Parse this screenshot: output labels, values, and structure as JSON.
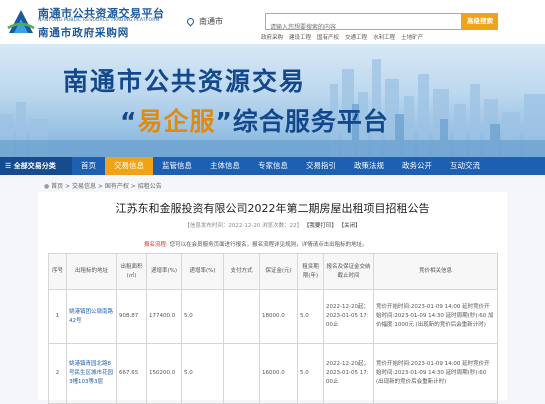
{
  "header": {
    "title_cn": "南通市公共资源交易平台",
    "title_en": "NANTONG PUBLIC RESOURCE TRADING PLATFORM",
    "subtitle_cn": "南通市政府采购网",
    "location": "南通市",
    "search_placeholder": "请输入您想要搜索的内容",
    "search_button": "高级搜索",
    "quick_links": [
      "政府采购",
      "建设工程",
      "国有产权",
      "交通工程",
      "水利工程",
      "土地矿产"
    ]
  },
  "banner": {
    "line1": "南通市公共资源交易",
    "line2_quote_open": "“",
    "line2_highlight": "易企服",
    "line2_quote_close": "”",
    "line2_rest": "综合服务平台"
  },
  "nav": {
    "category": "全部交易分类",
    "items": [
      "首页",
      "交易信息",
      "监管信息",
      "主体信息",
      "专家信息",
      "交易指引",
      "政策法规",
      "政务公开",
      "互动交流"
    ],
    "active_index": 1
  },
  "breadcrumb": "首页 > 交易信息 > 国有产权 > 招租公告",
  "article": {
    "title": "江苏东和金服投资有限公司2022年第二期房屋出租项目招租公告",
    "meta_prefix": "【信息发布时间：2022-12-20  浏览次数：22】",
    "print_label": "【我要打印】",
    "close_label": "【关闭】",
    "notice_label": "报名流程:",
    "notice_text": "您可以在会员服务页面进行报名，报名流程详见规则，详情请点击出租标的地址。"
  },
  "table": {
    "headers": [
      "序号",
      "出租标的地址",
      "出租面积(㎡)",
      "递增率(%)",
      "递增率(%)",
      "支付方式",
      "保证金(元)",
      "租赁期限(年)",
      "报名及保证金交纳截止时间",
      "竞价相关信息"
    ],
    "rows": [
      {
        "no": "1",
        "address": "姚港镇团公墩南路42号",
        "area": "908.87",
        "price": "177400.0",
        "rate": "5.0",
        "pay": "",
        "deposit": "18000.0",
        "term": "5.0",
        "deadline": "2022-12-20起；2023-01-05 17:00止",
        "bid": "竞价开始时间:2023-01-09 14:00 延时竞价开始时间:2023-01-09 14:30 延时周期(秒):60 加价幅度:1000元 (出现新的竞价后会重新计时)"
      },
      {
        "no": "2",
        "address": "姚港镇青园北路8号民生区城市花园3幢103等3层",
        "area": "667.65",
        "price": "150200.0",
        "rate": "5.0",
        "pay": "",
        "deposit": "16000.0",
        "term": "5.0",
        "deadline": "2022-12-20起；2023-01-05 17:00止",
        "bid": "竞价开始时间:2023-01-09 14:00 延时竞价开始时间:2023-01-09 14:30 延时周期(秒):60 (出现新的竞价后会重新计时)"
      }
    ]
  },
  "colors": {
    "brand_blue": "#1c5fb3",
    "accent_orange": "#f0a318",
    "notice_red": "#d03030"
  }
}
